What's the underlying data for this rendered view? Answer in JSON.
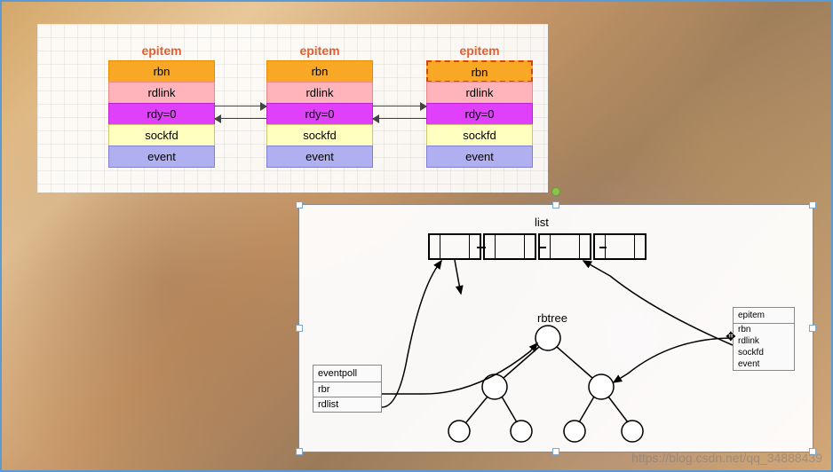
{
  "top": {
    "label": "epitem",
    "fields": {
      "rbn": "rbn",
      "rdlink": "rdlink",
      "rdy": "rdy=0",
      "sockfd": "sockfd",
      "event": "event"
    }
  },
  "bottom": {
    "list_label": "list",
    "rbtree_label": "rbtree",
    "eventpoll": {
      "title": "eventpoll",
      "rbr": "rbr",
      "rdlist": "rdlist"
    },
    "epitem": {
      "title": "epitem",
      "rbn": "rbn",
      "rdlink": "rdlink",
      "sockfd": "sockfd",
      "event": "event"
    }
  },
  "watermark": "https://blog.csdn.net/qq_34888439"
}
